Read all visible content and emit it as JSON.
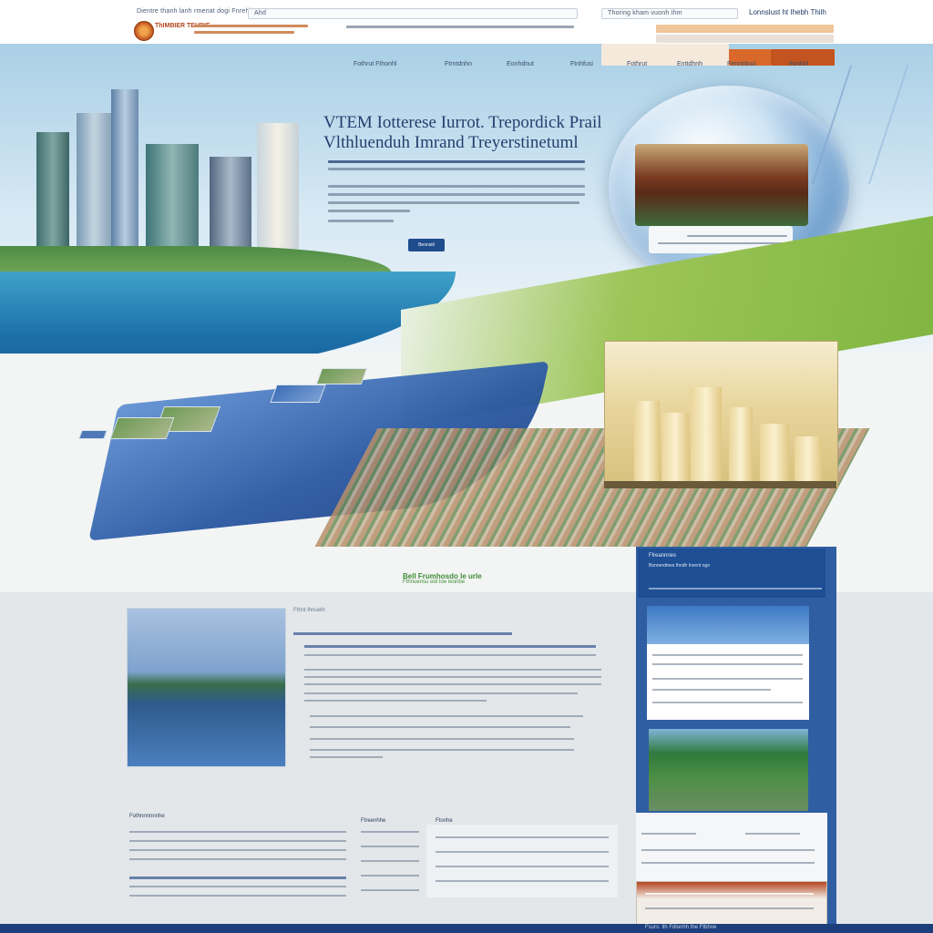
{
  "topbar": {
    "breadcrumb": "Dientre thanh lanh rmenat dogi Fnrehle",
    "search_placeholder": "Ahd",
    "select_value": "Thoring kham vuonh Ihm",
    "lang_link": "Lonnslust ht Ihebh Thilh",
    "brand_name": "ThIMBIER TEHBIE"
  },
  "hero": {
    "nav": [
      "Fothrut Fthonhl",
      "Ftrntdnhn",
      "Eonhdnut",
      "Ftnhfusi",
      "Fothrut",
      "Enttdhnh",
      "Fenntdnut",
      "Fonhhl"
    ],
    "headline_1": "VTEM Iotterese Iurrot. Trepordick Prail",
    "headline_2": "Vlthluenduh Imrand Treyerstinetuml",
    "button_label": "Beonsiit"
  },
  "section": {
    "title": "Bell Frumhosdo le urle",
    "subtitle": "Fthnuensu eid Ioe Ieonbe"
  },
  "article": {
    "kicker": "Fthnt lhnuelh"
  },
  "sidebar": {
    "title": "Flreannnes",
    "subtitle": "Bonnerdmes Ihndh Invent nge"
  },
  "bottom": {
    "col1_head": "Fothnnnnnnhe",
    "col2_head": "Ftreenhhe",
    "col3_head": "Ftonhe"
  },
  "footer": {
    "text": "Fsurs: Ilh Fdlonhh Ihe Ftbhne"
  },
  "colors": {
    "brand_orange": "#c0501e",
    "primary_blue": "#1f4c8c",
    "accent_green": "#7fb541",
    "sky": "#a9cfe6"
  },
  "icons": [
    "logo-emblem"
  ]
}
